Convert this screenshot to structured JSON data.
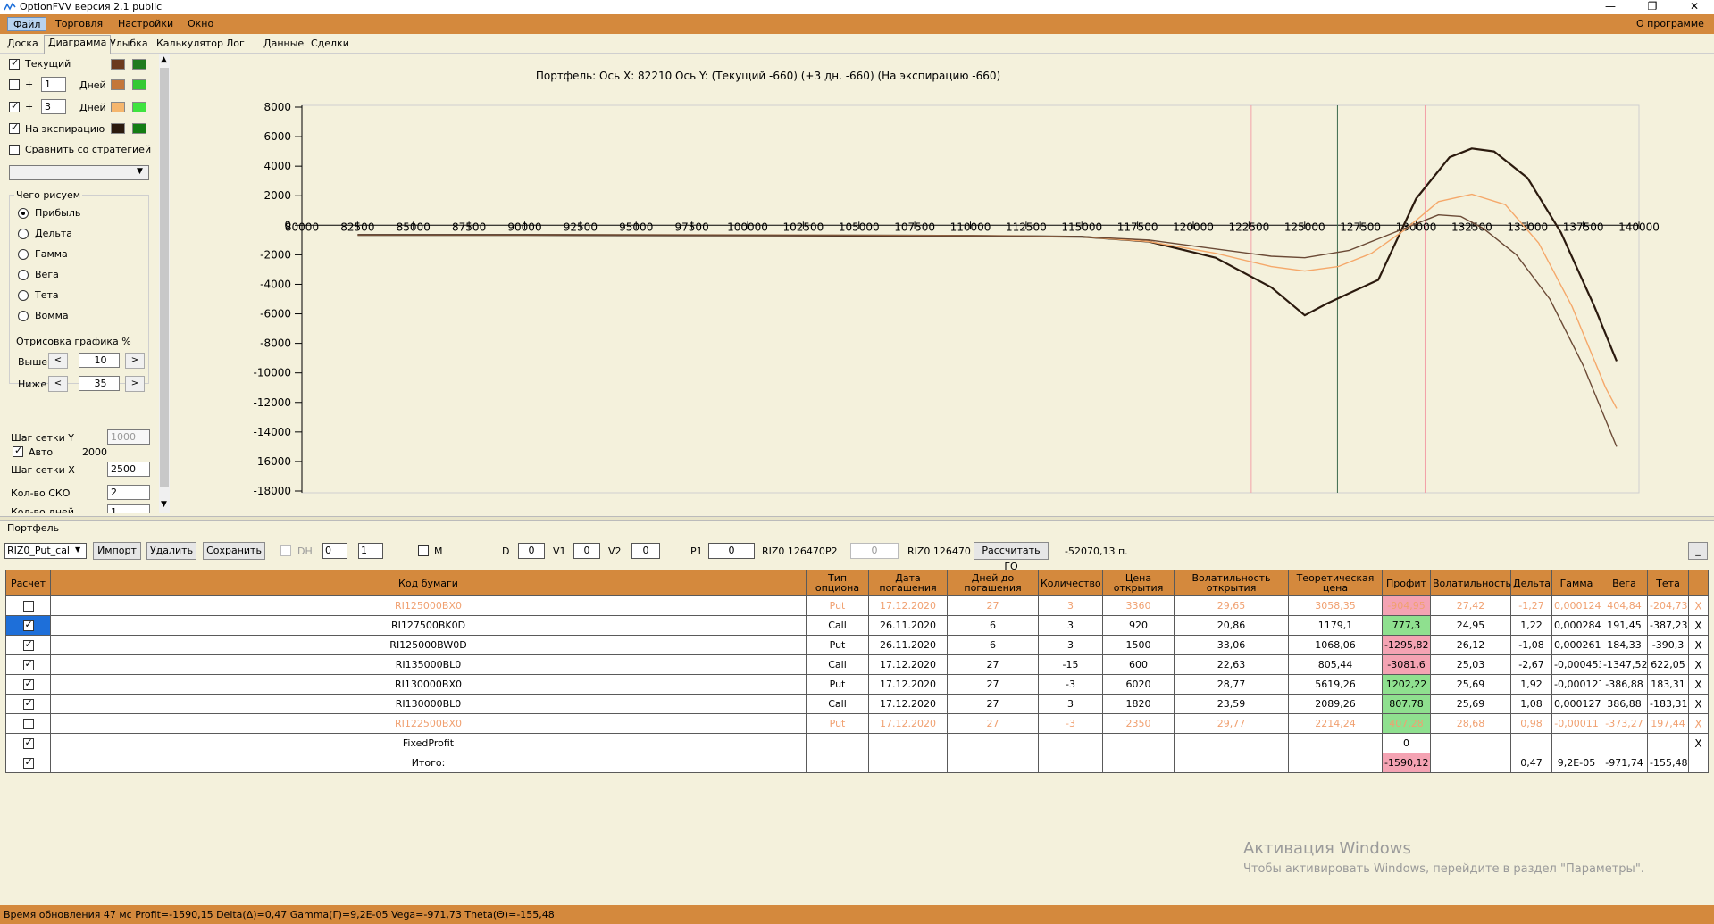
{
  "window": {
    "title": "OptionFVV версия 2.1 public",
    "about": "О программе"
  },
  "menu": [
    "Файл",
    "Торговля",
    "Настройки",
    "Окно"
  ],
  "tabs": [
    "Доска",
    "Диаграмма",
    "Улыбка",
    "Калькулятор",
    "Лог",
    "Данные",
    "Сделки"
  ],
  "left": {
    "current_label": "Текущий",
    "plus": "+",
    "days1": "1",
    "days2": "3",
    "days_label": "Дней",
    "expiry_label": "На экспирацию",
    "compare_label": "Сравнить со стратегией",
    "draw_title": "Чего рисуем",
    "draw_options": [
      "Прибыль",
      "Дельта",
      "Гамма",
      "Вега",
      "Тета",
      "Вомма"
    ],
    "render_title": "Отрисовка графика %",
    "above_label": "Выше",
    "above_value": "10",
    "below_label": "Ниже",
    "below_value": "35",
    "gridy_label": "Шаг сетки Y",
    "gridy_value": "1000",
    "auto_label": "Авто",
    "auto_value": "2000",
    "gridx_label": "Шаг сетки X",
    "gridx_value": "2500",
    "sko_label": "Кол-во СКО",
    "sko_value": "2",
    "days_cut_label": "Кол-во дней",
    "days_cut_value": "1",
    "colors": {
      "current_a": "#6b3a1e",
      "current_b": "#1f7a1f",
      "d1_a": "#c4773a",
      "d1_b": "#34c934",
      "d3_a": "#f5b66d",
      "d3_b": "#3fe33f",
      "exp_a": "#2b1a0e",
      "exp_b": "#137d13"
    }
  },
  "chart_data": {
    "type": "line",
    "title": "Портфель:  Ось X:  82210 Ось Y:   (Текущий -660)   (+3 дн.  -660)   (На экспирацию -660)",
    "xlim": [
      80000,
      140000
    ],
    "ylim": [
      -18000,
      8000
    ],
    "x_ticks": [
      "80000",
      "82500",
      "85000",
      "87500",
      "90000",
      "92500",
      "95000",
      "97500",
      "100000",
      "102500",
      "105000",
      "107500",
      "110000",
      "112500",
      "115000",
      "117500",
      "120000",
      "122500",
      "125000",
      "127500",
      "130000",
      "132500",
      "135000",
      "137500",
      "140000"
    ],
    "y_ticks": [
      "8000",
      "6000",
      "4000",
      "2000",
      "0",
      "-2000",
      "-4000",
      "-6000",
      "-8000",
      "-10000",
      "-12000",
      "-14000",
      "-16000",
      "-18000"
    ],
    "vlines": [
      {
        "x": 122600,
        "color": "#f2a0a8"
      },
      {
        "x": 126470,
        "color": "#3d6a4e"
      },
      {
        "x": 130400,
        "color": "#f2a0a8"
      }
    ],
    "series": [
      {
        "color": "#2b1a0e",
        "width": 2.2,
        "x": [
          82500,
          90000,
          100000,
          110000,
          115000,
          118000,
          121000,
          123500,
          125000,
          126000,
          127000,
          128300,
          130000,
          131500,
          132500,
          133500,
          135000,
          136500,
          138000,
          139000
        ],
        "y": [
          -660,
          -660,
          -680,
          -720,
          -780,
          -1100,
          -2200,
          -4200,
          -6100,
          -5300,
          -4600,
          -3700,
          1800,
          4600,
          5200,
          5000,
          3200,
          -500,
          -5500,
          -9200
        ]
      },
      {
        "color": "#f5a86a",
        "width": 1.4,
        "x": [
          82500,
          90000,
          100000,
          110000,
          115000,
          118000,
          121000,
          123500,
          125000,
          126500,
          128000,
          129500,
          131000,
          132500,
          134000,
          135500,
          137000,
          138500,
          139000
        ],
        "y": [
          -660,
          -660,
          -670,
          -700,
          -780,
          -1100,
          -1900,
          -2800,
          -3100,
          -2800,
          -1900,
          -300,
          1600,
          2100,
          1400,
          -1200,
          -5500,
          -11000,
          -12400
        ]
      },
      {
        "color": "#6b4a36",
        "width": 1.4,
        "x": [
          82500,
          90000,
          100000,
          110000,
          115000,
          118000,
          121000,
          123500,
          125000,
          127000,
          129000,
          131000,
          132000,
          133000,
          134500,
          136000,
          137500,
          139000
        ],
        "y": [
          -660,
          -660,
          -680,
          -720,
          -780,
          -1000,
          -1600,
          -2100,
          -2200,
          -1700,
          -500,
          700,
          600,
          -200,
          -2000,
          -5000,
          -9500,
          -15000
        ]
      }
    ]
  },
  "portfolio": {
    "label": "Портфель",
    "select_value": "RIZ0_Put_cal",
    "import_label": "Импорт",
    "delete_label": "Удалить",
    "save_label": "Сохранить",
    "dh_label": "DH",
    "dh_v1": "0",
    "dh_v2": "1",
    "m_label": "M",
    "d_label": "D",
    "d_value": "0",
    "v1_label": "V1",
    "v1_value": "0",
    "v2_label": "V2",
    "v2_value": "0",
    "p1_label": "P1",
    "p1_value": "0",
    "p1_ticker": "RIZ0 126470",
    "p2_label": "P2",
    "p2_value": "0",
    "p2_ticker": "RIZ0 126470",
    "calc_label": "Рассчитать ГО",
    "go_value": "-52070,13 п.",
    "small_btn": "_"
  },
  "grid": {
    "headers": [
      "Расчет",
      "Код бумаги",
      "Тип опциона",
      "Дата погашения",
      "Дней до погашения",
      "Количество",
      "Цена открытия",
      "Волатильность открытия",
      "Теоретическая цена",
      "Профит",
      "Волатильность",
      "Дельта",
      "Гамма",
      "Вега",
      "Тета",
      ""
    ],
    "rows": [
      {
        "check": false,
        "state": "inactive",
        "cells": [
          "RI125000BX0",
          "Put",
          "17.12.2020",
          "27",
          "3",
          "3360",
          "29,65",
          "3058,35",
          "-904,95",
          "27,42",
          "-1,27",
          "0,000124",
          "404,84",
          "-204,73",
          "X"
        ]
      },
      {
        "check": true,
        "state": "selected",
        "cells": [
          "RI127500BK0D",
          "Call",
          "26.11.2020",
          "6",
          "3",
          "920",
          "20,86",
          "1179,1",
          "777,3",
          "24,95",
          "1,22",
          "0,000284",
          "191,45",
          "-387,23",
          "X"
        ]
      },
      {
        "check": true,
        "state": "",
        "cells": [
          "RI125000BW0D",
          "Put",
          "26.11.2020",
          "6",
          "3",
          "1500",
          "33,06",
          "1068,06",
          "-1295,82",
          "26,12",
          "-1,08",
          "0,000261",
          "184,33",
          "-390,3",
          "X"
        ]
      },
      {
        "check": true,
        "state": "",
        "cells": [
          "RI135000BL0",
          "Call",
          "17.12.2020",
          "27",
          "-15",
          "600",
          "22,63",
          "805,44",
          "-3081,6",
          "25,03",
          "-2,67",
          "-0,000453",
          "-1347,52",
          "622,05",
          "X"
        ]
      },
      {
        "check": true,
        "state": "",
        "cells": [
          "RI130000BX0",
          "Put",
          "17.12.2020",
          "27",
          "-3",
          "6020",
          "28,77",
          "5619,26",
          "1202,22",
          "25,69",
          "1,92",
          "-0,000127",
          "-386,88",
          "183,31",
          "X"
        ]
      },
      {
        "check": true,
        "state": "",
        "cells": [
          "RI130000BL0",
          "Call",
          "17.12.2020",
          "27",
          "3",
          "1820",
          "23,59",
          "2089,26",
          "807,78",
          "25,69",
          "1,08",
          "0,000127",
          "386,88",
          "-183,31",
          "X"
        ]
      },
      {
        "check": false,
        "state": "inactive",
        "cells": [
          "RI122500BX0",
          "Put",
          "17.12.2020",
          "27",
          "-3",
          "2350",
          "29,77",
          "2214,24",
          "407,28",
          "28,68",
          "0,98",
          "-0,00011",
          "-373,27",
          "197,44",
          "X"
        ]
      },
      {
        "check": true,
        "state": "",
        "cells": [
          "FixedProfit",
          "",
          "",
          "",
          "",
          "",
          "",
          "",
          "0",
          "",
          "",
          "",
          "",
          "",
          "X"
        ]
      },
      {
        "check": true,
        "state": "",
        "cells": [
          "Итого:",
          "",
          "",
          "",
          "",
          "",
          "",
          "",
          "-1590,12",
          "",
          "0,47",
          "9,2E-05",
          "-971,74",
          "-155,48",
          ""
        ]
      }
    ]
  },
  "watermark": {
    "line1": "Активация Windows",
    "line2": "Чтобы активировать Windows, перейдите в раздел \"Параметры\"."
  },
  "status": "Время обновления 47 мс  Profit=-1590,15 Delta(Δ)=0,47 Gamma(Γ)=9,2E-05 Vega=-971,73 Theta(Θ)=-155,48"
}
